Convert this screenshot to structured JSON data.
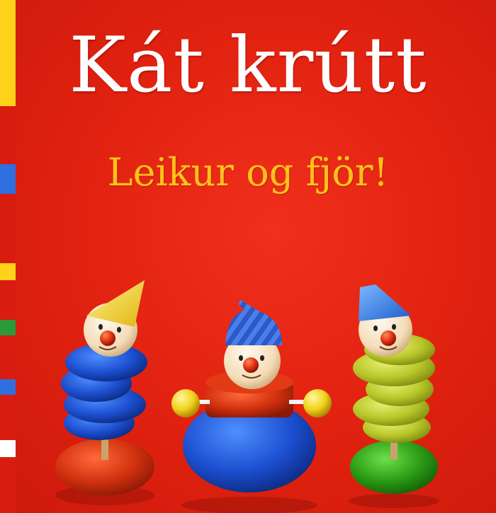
{
  "cover": {
    "title": "Kát krútt",
    "subtitle": "Leikur og fjör!"
  },
  "colors": {
    "background": "#e0210f",
    "title_text": "#ffffff",
    "subtitle_text": "#ffc21a",
    "spine_strips": [
      "#ffd21a",
      "#2f6fe0",
      "#ffd21a",
      "#2a9a3a",
      "#2f6fe0",
      "#ffffff"
    ]
  },
  "illustration": {
    "toys": [
      "left-clown-stacking-toy",
      "middle-clown-roly-poly-toy",
      "right-clown-stacking-toy"
    ]
  }
}
